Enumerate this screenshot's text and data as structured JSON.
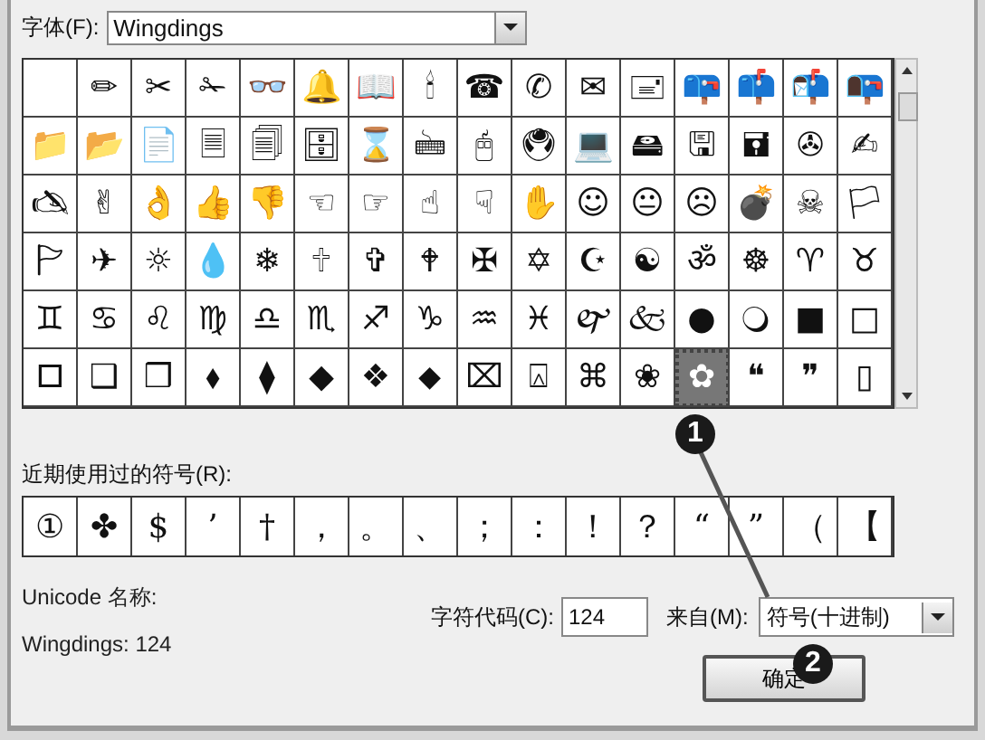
{
  "font": {
    "label": "字体(F):",
    "value": "Wingdings"
  },
  "symbols": [
    {
      "selected": false
    },
    {
      "glyph": "✏",
      "selected": false
    },
    {
      "glyph": "✂",
      "selected": false
    },
    {
      "glyph": "✁",
      "selected": false
    },
    {
      "glyph": "👓",
      "selected": false
    },
    {
      "glyph": "🔔",
      "selected": false
    },
    {
      "glyph": "📖",
      "selected": false
    },
    {
      "glyph": "🕯",
      "selected": false
    },
    {
      "glyph": "☎",
      "selected": false
    },
    {
      "glyph": "✆",
      "selected": false
    },
    {
      "glyph": "✉",
      "selected": false
    },
    {
      "glyph": "🖃",
      "selected": false
    },
    {
      "glyph": "📪",
      "selected": false
    },
    {
      "glyph": "📫",
      "selected": false
    },
    {
      "glyph": "📬",
      "selected": false
    },
    {
      "glyph": "📭",
      "selected": false
    },
    {
      "glyph": "📁",
      "selected": false
    },
    {
      "glyph": "📂",
      "selected": false
    },
    {
      "glyph": "📄",
      "selected": false
    },
    {
      "glyph": "🗏",
      "selected": false
    },
    {
      "glyph": "🗐",
      "selected": false
    },
    {
      "glyph": "🗄",
      "selected": false
    },
    {
      "glyph": "⌛",
      "selected": false
    },
    {
      "glyph": "🖮",
      "selected": false
    },
    {
      "glyph": "🖰",
      "selected": false
    },
    {
      "glyph": "🖲",
      "selected": false
    },
    {
      "glyph": "💻",
      "selected": false
    },
    {
      "glyph": "🖴",
      "selected": false
    },
    {
      "glyph": "🖫",
      "selected": false
    },
    {
      "glyph": "🖬",
      "selected": false
    },
    {
      "glyph": "✇",
      "selected": false
    },
    {
      "glyph": "✍",
      "selected": false
    },
    {
      "glyph": "🖎",
      "selected": false
    },
    {
      "glyph": "✌",
      "selected": false
    },
    {
      "glyph": "👌",
      "selected": false
    },
    {
      "glyph": "👍",
      "selected": false
    },
    {
      "glyph": "👎",
      "selected": false
    },
    {
      "glyph": "☜",
      "selected": false
    },
    {
      "glyph": "☞",
      "selected": false
    },
    {
      "glyph": "☝",
      "selected": false
    },
    {
      "glyph": "☟",
      "selected": false
    },
    {
      "glyph": "✋",
      "selected": false
    },
    {
      "glyph": "☺",
      "selected": false
    },
    {
      "glyph": "😐",
      "selected": false
    },
    {
      "glyph": "☹",
      "selected": false
    },
    {
      "glyph": "💣",
      "selected": false
    },
    {
      "glyph": "☠",
      "selected": false
    },
    {
      "glyph": "🏳",
      "selected": false
    },
    {
      "glyph": "🏱",
      "selected": false
    },
    {
      "glyph": "✈",
      "selected": false
    },
    {
      "glyph": "☼",
      "selected": false
    },
    {
      "glyph": "💧",
      "selected": false
    },
    {
      "glyph": "❄",
      "selected": false
    },
    {
      "glyph": "🕆",
      "selected": false
    },
    {
      "glyph": "✞",
      "selected": false
    },
    {
      "glyph": "🕈",
      "selected": false
    },
    {
      "glyph": "✠",
      "selected": false
    },
    {
      "glyph": "✡",
      "selected": false
    },
    {
      "glyph": "☪",
      "selected": false
    },
    {
      "glyph": "☯",
      "selected": false
    },
    {
      "glyph": "ॐ",
      "selected": false
    },
    {
      "glyph": "☸",
      "selected": false
    },
    {
      "glyph": "♈",
      "selected": false
    },
    {
      "glyph": "♉",
      "selected": false
    },
    {
      "glyph": "♊",
      "selected": false
    },
    {
      "glyph": "♋",
      "selected": false
    },
    {
      "glyph": "♌",
      "selected": false
    },
    {
      "glyph": "♍",
      "selected": false
    },
    {
      "glyph": "♎",
      "selected": false
    },
    {
      "glyph": "♏",
      "selected": false
    },
    {
      "glyph": "♐",
      "selected": false
    },
    {
      "glyph": "♑",
      "selected": false
    },
    {
      "glyph": "♒",
      "selected": false
    },
    {
      "glyph": "♓",
      "selected": false
    },
    {
      "glyph": "🙰",
      "selected": false
    },
    {
      "glyph": "🙵",
      "selected": false
    },
    {
      "glyph": "●",
      "selected": false
    },
    {
      "glyph": "🔾",
      "selected": false
    },
    {
      "glyph": "■",
      "selected": false
    },
    {
      "glyph": "□",
      "selected": false
    },
    {
      "glyph": "🞐",
      "selected": false
    },
    {
      "glyph": "❑",
      "selected": false
    },
    {
      "glyph": "❒",
      "selected": false
    },
    {
      "glyph": "⬧",
      "selected": false
    },
    {
      "glyph": "⧫",
      "selected": false
    },
    {
      "glyph": "◆",
      "selected": false
    },
    {
      "glyph": "❖",
      "selected": false
    },
    {
      "glyph": "⬥",
      "selected": false
    },
    {
      "glyph": "⌧",
      "selected": false
    },
    {
      "glyph": "⍓",
      "selected": false
    },
    {
      "glyph": "⌘",
      "selected": false
    },
    {
      "glyph": "❀",
      "selected": false
    },
    {
      "glyph": "✿",
      "selected": true
    },
    {
      "glyph": "❝",
      "selected": false
    },
    {
      "glyph": "❞",
      "selected": false
    },
    {
      "glyph": "▯",
      "selected": false
    }
  ],
  "recent": {
    "label": "近期使用过的符号(R):",
    "symbols": [
      "①",
      "✤",
      "$",
      "’",
      "†",
      "，",
      "。",
      "、",
      "；",
      "：",
      "！",
      "？",
      "“",
      "”",
      "（",
      "【"
    ]
  },
  "unicode_name": {
    "label": "Unicode 名称:",
    "value": "Wingdings: 124"
  },
  "char_code": {
    "label": "字符代码(C):",
    "value": "124"
  },
  "from": {
    "label": "来自(M):",
    "value": "符号(十进制)"
  },
  "buttons": [
    "确定"
  ],
  "callouts": [
    "1",
    "2"
  ]
}
